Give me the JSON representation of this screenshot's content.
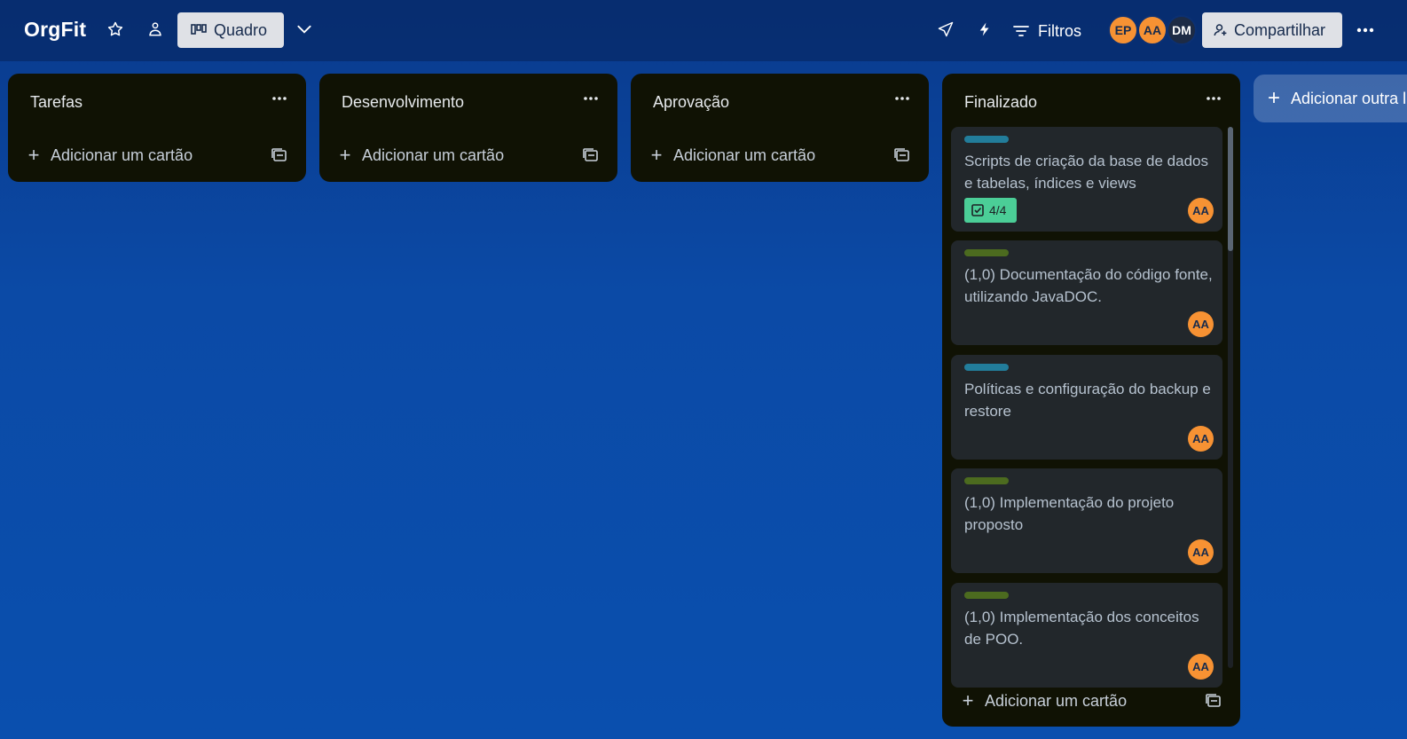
{
  "board": {
    "title": "OrgFit",
    "view_label": "Quadro",
    "filters_label": "Filtros",
    "share_label": "Compartilhar",
    "members": [
      {
        "initials": "EP",
        "color": "#f79233"
      },
      {
        "initials": "AA",
        "color": "#f79233"
      },
      {
        "initials": "DM",
        "color": "#1d2b45"
      }
    ]
  },
  "lists": [
    {
      "title": "Tarefas",
      "add_card_label": "Adicionar um cartão"
    },
    {
      "title": "Desenvolvimento",
      "add_card_label": "Adicionar um cartão"
    },
    {
      "title": "Aprovação",
      "add_card_label": "Adicionar um cartão"
    },
    {
      "title": "Finalizado",
      "add_card_label": "Adicionar um cartão",
      "cards": [
        {
          "label_color": "#227d9b",
          "title": "Scripts de criação da base de dados e tabelas, índices e views",
          "checklist": "4/4",
          "member": "AA"
        },
        {
          "label_color": "#4c6b1f",
          "title": "(1,0) Documentação do código fonte, utilizando JavaDOC.",
          "member": "AA"
        },
        {
          "label_color": "#227d9b",
          "title": "Políticas e configuração do backup e restore",
          "member": "AA"
        },
        {
          "label_color": "#4c6b1f",
          "title": "(1,0) Implementação do projeto proposto",
          "member": "AA"
        },
        {
          "label_color": "#4c6b1f",
          "title": "(1,0) Implementação dos conceitos de POO.",
          "member": "AA"
        }
      ]
    }
  ],
  "add_list_label": "Adicionar outra lista",
  "colors": {
    "list_bg": "#101204",
    "card_bg": "#22272b",
    "label_teal": "#227d9b",
    "label_green": "#4c6b1f",
    "checklist_complete": "#4bce97",
    "avatar_orange": "#f79233"
  }
}
